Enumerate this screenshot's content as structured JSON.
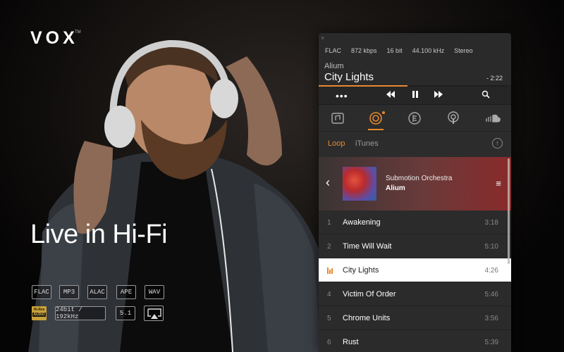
{
  "promo": {
    "logo": "VOX",
    "logo_tm": "TM",
    "tagline": "Live in Hi-Fi",
    "formats_row1": [
      "FLAC",
      "MP3",
      "ALAC",
      "APE",
      "WAV"
    ],
    "formats_row2": [
      "24bit / 192kHz",
      "5.1"
    ],
    "hires_top": "Hi-Res",
    "hires_bottom": "AUDIO"
  },
  "player": {
    "close": "×",
    "meta": [
      "FLAC",
      "872 kbps",
      "16 bit",
      "44.100 kHz",
      "Stereo"
    ],
    "now_playing_artist": "Alium",
    "now_playing_title": "City Lights",
    "remaining": "- 2:22",
    "progress_fraction": 0.46,
    "accent_color": "#e8892c",
    "tabs": [
      "Loop",
      "iTunes"
    ],
    "active_tab": "Loop",
    "album_artist": "Submotion Orchestra",
    "album_name": "Alium",
    "tracks": [
      {
        "num": "1",
        "name": "Awakening",
        "dur": "3:18"
      },
      {
        "num": "2",
        "name": "Time Will Wait",
        "dur": "5:10"
      },
      {
        "num": "",
        "name": "City Lights",
        "dur": "4:26",
        "active": true
      },
      {
        "num": "4",
        "name": "Victim Of Order",
        "dur": "5:46"
      },
      {
        "num": "5",
        "name": "Chrome Units",
        "dur": "3:56"
      },
      {
        "num": "6",
        "name": "Rust",
        "dur": "5:39"
      }
    ]
  }
}
